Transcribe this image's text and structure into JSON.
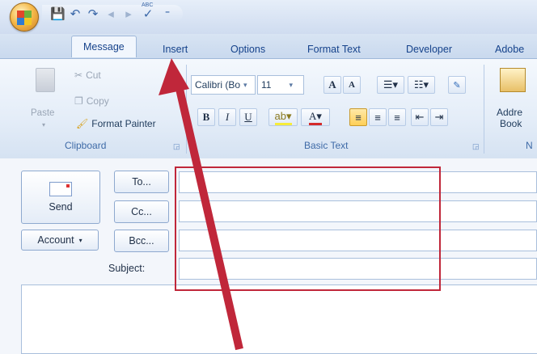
{
  "quick_access": {
    "icons": [
      "save-icon",
      "undo-icon",
      "redo-icon",
      "previous-icon",
      "next-icon",
      "spelling-icon",
      "customize-qat-icon"
    ],
    "glyphs": [
      "💾",
      "↶",
      "↷",
      "◂",
      "▸",
      "✓",
      "⁼"
    ],
    "spelling_label": "ABC"
  },
  "tabs": [
    "Message",
    "Insert",
    "Options",
    "Format Text",
    "Developer",
    "Adobe"
  ],
  "clipboard": {
    "paste_label": "Paste",
    "cut_label": "Cut",
    "copy_label": "Copy",
    "format_painter_label": "Format Painter",
    "group_label": "Clipboard"
  },
  "basic_text": {
    "font_name": "Calibri (Bo",
    "font_size": "11",
    "bold": "B",
    "italic": "I",
    "underline": "U",
    "grow": "A",
    "shrink": "A",
    "font_color": "A",
    "group_label": "Basic Text"
  },
  "names_group": {
    "address_book_line1": "Addre",
    "address_book_line2": "Book",
    "group_label_partial": "N"
  },
  "compose": {
    "send_label": "Send",
    "to_label": "To...",
    "cc_label": "Cc...",
    "bcc_label": "Bcc...",
    "account_label": "Account",
    "subject_label": "Subject:"
  },
  "annotation_color": "#c0273a"
}
